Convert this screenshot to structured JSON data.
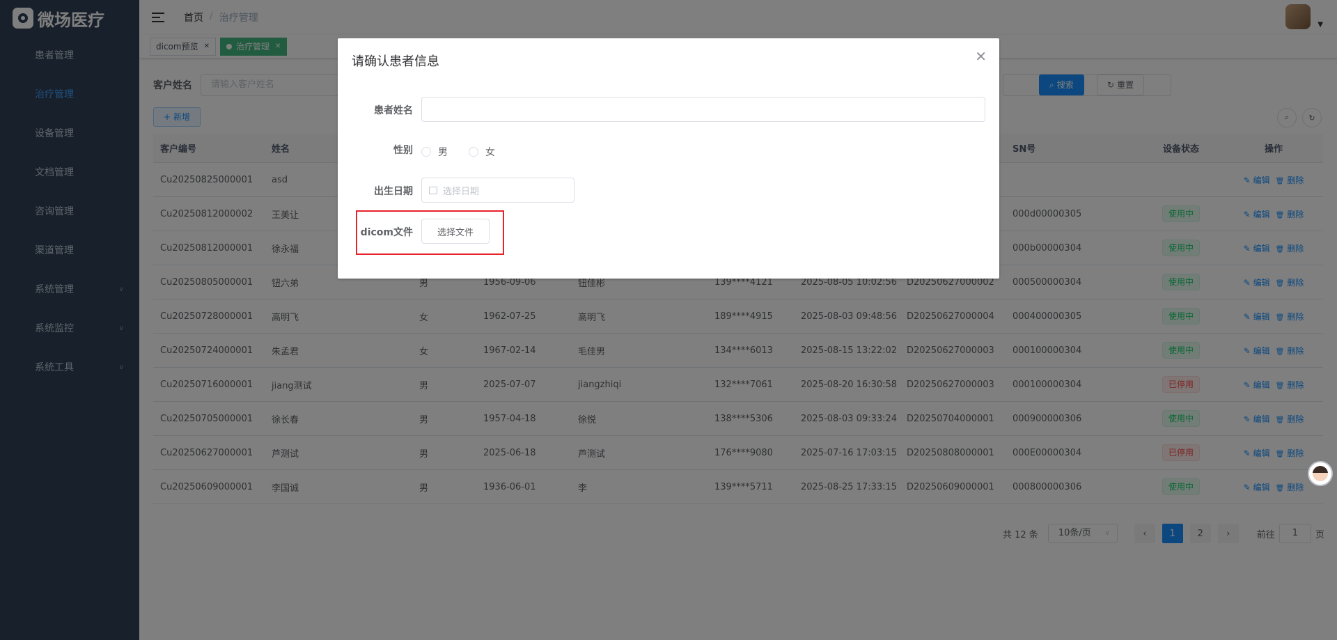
{
  "app": {
    "logo_text": "微场医疗"
  },
  "sidebar": {
    "items": [
      {
        "label": "患者管理",
        "active": false,
        "has_children": false
      },
      {
        "label": "治疗管理",
        "active": true,
        "has_children": false
      },
      {
        "label": "设备管理",
        "active": false,
        "has_children": false
      },
      {
        "label": "文档管理",
        "active": false,
        "has_children": false
      },
      {
        "label": "咨询管理",
        "active": false,
        "has_children": false
      },
      {
        "label": "渠道管理",
        "active": false,
        "has_children": false
      },
      {
        "label": "系统管理",
        "active": false,
        "has_children": true
      },
      {
        "label": "系统监控",
        "active": false,
        "has_children": true
      },
      {
        "label": "系统工具",
        "active": false,
        "has_children": true
      }
    ]
  },
  "navbar": {
    "breadcrumb": {
      "home": "首页",
      "separator": "/",
      "current": "治疗管理"
    }
  },
  "tags": [
    {
      "label": "dicom预览",
      "active": false
    },
    {
      "label": "治疗管理",
      "active": true
    }
  ],
  "search": {
    "customer_name_label": "客户姓名",
    "customer_name_placeholder": "请输入客户姓名",
    "search_button": "搜索",
    "reset_button": "重置",
    "add_button": "新增"
  },
  "table": {
    "columns": [
      "客户编号",
      "姓名",
      "",
      "",
      "",
      "",
      "",
      "",
      "SN号",
      "设备状态",
      "操作"
    ],
    "rows": [
      {
        "id": "Cu20250825000001",
        "name": "asd",
        "gender": "",
        "birth": "",
        "contact": "",
        "phone": "",
        "time": "",
        "device": "",
        "sn": "",
        "status": "",
        "status_type": ""
      },
      {
        "id": "Cu20250812000002",
        "name": "王美让",
        "gender": "",
        "birth": "",
        "contact": "",
        "phone": "",
        "time": "",
        "device": "",
        "sn": "000d00000305",
        "status": "使用中",
        "status_type": "on"
      },
      {
        "id": "Cu20250812000001",
        "name": "徐永福",
        "gender": "",
        "birth": "",
        "contact": "",
        "phone": "",
        "time": "",
        "device": "",
        "sn": "000b00000304",
        "status": "使用中",
        "status_type": "on"
      },
      {
        "id": "Cu20250805000001",
        "name": "钮六弟",
        "gender": "男",
        "birth": "1956-09-06",
        "contact": "钮佳彬",
        "phone": "139****4121",
        "time": "2025-08-05 10:02:56",
        "device": "D20250627000002",
        "sn": "000500000304",
        "status": "使用中",
        "status_type": "on"
      },
      {
        "id": "Cu20250728000001",
        "name": "高明飞",
        "gender": "女",
        "birth": "1962-07-25",
        "contact": "高明飞",
        "phone": "189****4915",
        "time": "2025-08-03 09:48:56",
        "device": "D20250627000004",
        "sn": "000400000305",
        "status": "使用中",
        "status_type": "on"
      },
      {
        "id": "Cu20250724000001",
        "name": "朱孟君",
        "gender": "女",
        "birth": "1967-02-14",
        "contact": "毛佳男",
        "phone": "134****6013",
        "time": "2025-08-15 13:22:02",
        "device": "D20250627000003",
        "sn": "000100000304",
        "status": "使用中",
        "status_type": "on"
      },
      {
        "id": "Cu20250716000001",
        "name": "jiang测试",
        "gender": "男",
        "birth": "2025-07-07",
        "contact": "jiangzhiqi",
        "phone": "132****7061",
        "time": "2025-08-20 16:30:58",
        "device": "D20250627000003",
        "sn": "000100000304",
        "status": "已停用",
        "status_type": "off"
      },
      {
        "id": "Cu20250705000001",
        "name": "徐长春",
        "gender": "男",
        "birth": "1957-04-18",
        "contact": "徐悦",
        "phone": "138****5306",
        "time": "2025-08-03 09:33:24",
        "device": "D20250704000001",
        "sn": "000900000306",
        "status": "使用中",
        "status_type": "on"
      },
      {
        "id": "Cu20250627000001",
        "name": "芦测试",
        "gender": "男",
        "birth": "2025-06-18",
        "contact": "芦测试",
        "phone": "176****9080",
        "time": "2025-07-16 17:03:15",
        "device": "D20250808000001",
        "sn": "000E00000304",
        "status": "已停用",
        "status_type": "off"
      },
      {
        "id": "Cu20250609000001",
        "name": "李国诚",
        "gender": "男",
        "birth": "1936-06-01",
        "contact": "李",
        "phone": "139****5711",
        "time": "2025-08-25 17:33:15",
        "device": "D20250609000001",
        "sn": "000800000306",
        "status": "使用中",
        "status_type": "on"
      }
    ],
    "edit_label": "编辑",
    "delete_label": "删除"
  },
  "pagination": {
    "total": "共 12 条",
    "page_size": "10条/页",
    "pages": [
      "1",
      "2"
    ],
    "current_page": 1,
    "goto_prefix": "前往",
    "goto_value": "1",
    "goto_suffix": "页"
  },
  "modal": {
    "title": "请确认患者信息",
    "patient_name_label": "患者姓名",
    "gender_label": "性别",
    "gender_options": [
      "男",
      "女"
    ],
    "birth_label": "出生日期",
    "birth_placeholder": "选择日期",
    "dicom_label": "dicom文件",
    "file_button": "选择文件"
  },
  "colors": {
    "sidebar_bg": "#304156",
    "primary": "#1890ff",
    "active_tag": "#42b983",
    "highlight_border": "#e8222a"
  }
}
